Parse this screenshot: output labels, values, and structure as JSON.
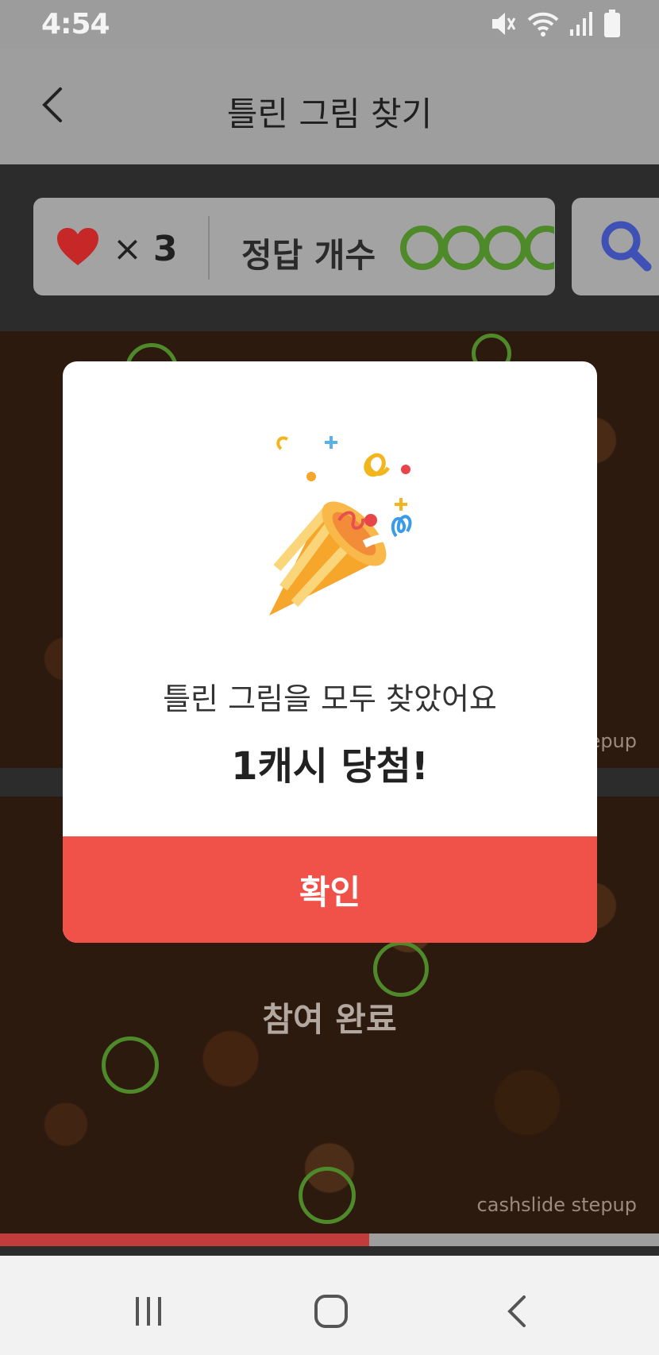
{
  "status_bar": {
    "time": "4:54"
  },
  "header": {
    "title": "틀린 그림 찾기"
  },
  "info_bar": {
    "lives_symbol": "×",
    "lives_count": "3",
    "answers_label": "정답 개수"
  },
  "game": {
    "completed_label": "참여 완료",
    "watermark_top": "stepup",
    "watermark_bottom": "cashslide stepup",
    "progress_fraction": 0.56
  },
  "modal": {
    "message": "틀린 그림을 모두 찾았어요",
    "prize": "1캐시 당첨!",
    "confirm_label": "확인"
  },
  "colors": {
    "accent_red": "#f05149",
    "ring_green": "#4e8a2a",
    "heart_red": "#c62828",
    "search_blue": "#3f51b5"
  },
  "icons": [
    "back-arrow-icon",
    "heart-icon",
    "search-icon",
    "mute-icon",
    "wifi-icon",
    "signal-icon",
    "battery-icon",
    "recents-icon",
    "home-icon",
    "nav-back-icon",
    "party-popper-icon"
  ]
}
